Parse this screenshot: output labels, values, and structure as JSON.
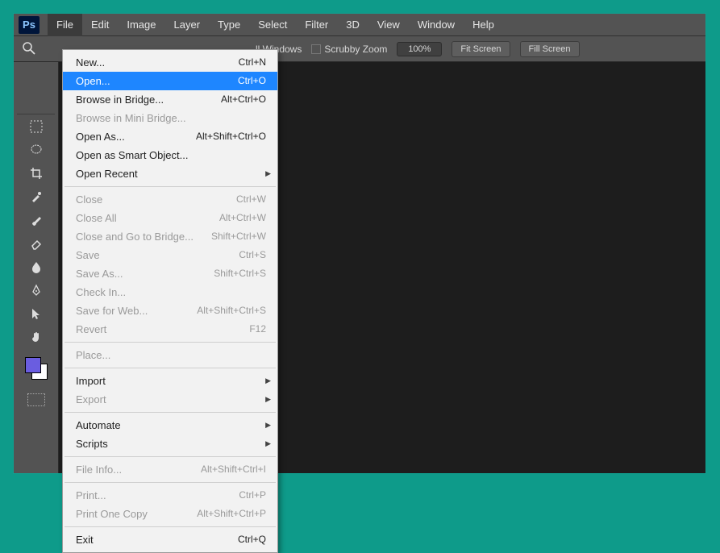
{
  "app_logo": "Ps",
  "menubar": [
    "File",
    "Edit",
    "Image",
    "Layer",
    "Type",
    "Select",
    "Filter",
    "3D",
    "View",
    "Window",
    "Help"
  ],
  "active_menu_index": 0,
  "options_bar": {
    "all_windows_label": "ll Windows",
    "scrubby_label": "Scrubby Zoom",
    "zoom_value": "100%",
    "fit_label": "Fit Screen",
    "fill_label": "Fill Screen"
  },
  "file_menu": [
    {
      "type": "item",
      "label": "New...",
      "shortcut": "Ctrl+N"
    },
    {
      "type": "item",
      "label": "Open...",
      "shortcut": "Ctrl+O",
      "highlight": true
    },
    {
      "type": "item",
      "label": "Browse in Bridge...",
      "shortcut": "Alt+Ctrl+O"
    },
    {
      "type": "item",
      "label": "Browse in Mini Bridge...",
      "disabled": true
    },
    {
      "type": "item",
      "label": "Open As...",
      "shortcut": "Alt+Shift+Ctrl+O"
    },
    {
      "type": "item",
      "label": "Open as Smart Object..."
    },
    {
      "type": "item",
      "label": "Open Recent",
      "submenu": true
    },
    {
      "type": "sep"
    },
    {
      "type": "item",
      "label": "Close",
      "shortcut": "Ctrl+W",
      "disabled": true
    },
    {
      "type": "item",
      "label": "Close All",
      "shortcut": "Alt+Ctrl+W",
      "disabled": true
    },
    {
      "type": "item",
      "label": "Close and Go to Bridge...",
      "shortcut": "Shift+Ctrl+W",
      "disabled": true
    },
    {
      "type": "item",
      "label": "Save",
      "shortcut": "Ctrl+S",
      "disabled": true
    },
    {
      "type": "item",
      "label": "Save As...",
      "shortcut": "Shift+Ctrl+S",
      "disabled": true
    },
    {
      "type": "item",
      "label": "Check In...",
      "disabled": true
    },
    {
      "type": "item",
      "label": "Save for Web...",
      "shortcut": "Alt+Shift+Ctrl+S",
      "disabled": true
    },
    {
      "type": "item",
      "label": "Revert",
      "shortcut": "F12",
      "disabled": true
    },
    {
      "type": "sep"
    },
    {
      "type": "item",
      "label": "Place...",
      "disabled": true
    },
    {
      "type": "sep"
    },
    {
      "type": "item",
      "label": "Import",
      "submenu": true
    },
    {
      "type": "item",
      "label": "Export",
      "submenu": true,
      "disabled": true
    },
    {
      "type": "sep"
    },
    {
      "type": "item",
      "label": "Automate",
      "submenu": true
    },
    {
      "type": "item",
      "label": "Scripts",
      "submenu": true
    },
    {
      "type": "sep"
    },
    {
      "type": "item",
      "label": "File Info...",
      "shortcut": "Alt+Shift+Ctrl+I",
      "disabled": true
    },
    {
      "type": "sep"
    },
    {
      "type": "item",
      "label": "Print...",
      "shortcut": "Ctrl+P",
      "disabled": true
    },
    {
      "type": "item",
      "label": "Print One Copy",
      "shortcut": "Alt+Shift+Ctrl+P",
      "disabled": true
    },
    {
      "type": "sep"
    },
    {
      "type": "item",
      "label": "Exit",
      "shortcut": "Ctrl+Q"
    }
  ],
  "tools": [
    "marquee",
    "lasso",
    "crop",
    "eyedropper",
    "brush",
    "eraser",
    "blur",
    "pen",
    "path-select",
    "hand"
  ]
}
